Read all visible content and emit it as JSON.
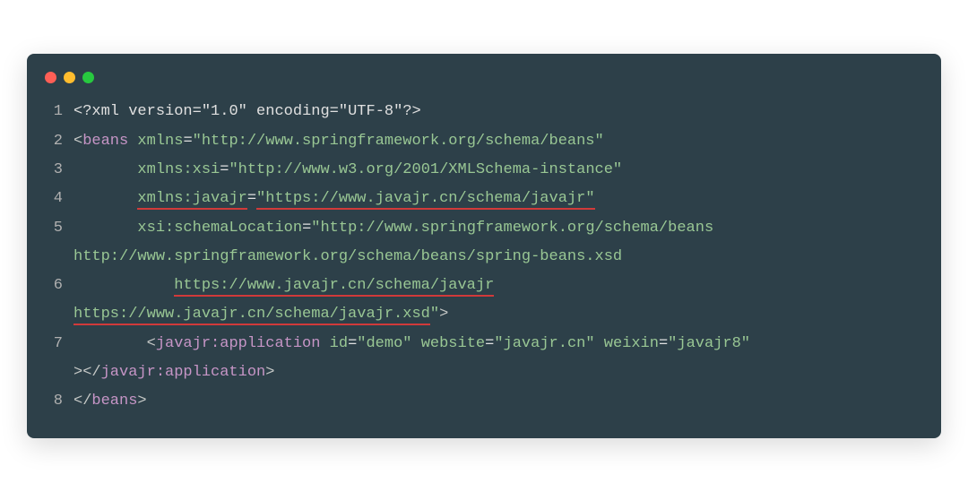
{
  "titlebar": {
    "dots": [
      "red",
      "yellow",
      "green"
    ]
  },
  "code": {
    "l1": {
      "pi_open": "<?",
      "pi_name": "xml",
      "version_attr": " version=",
      "version_val": "\"1.0\"",
      "encoding_attr": " encoding=",
      "encoding_val": "\"UTF-8\"",
      "pi_close": "?>"
    },
    "l2": {
      "open": "<",
      "tag": "beans",
      "attr": " xmlns",
      "eq": "=",
      "val": "\"http://www.springframework.org/schema/beans\""
    },
    "l3": {
      "indent": "       ",
      "attr": "xmlns:xsi",
      "eq": "=",
      "val": "\"http://www.w3.org/2001/XMLSchema-instance\""
    },
    "l4": {
      "indent": "       ",
      "attr": "xmlns:javajr",
      "eq": "=",
      "q1": "\"",
      "url": "https://www.javajr.cn/schema/javajr",
      "q2": "\""
    },
    "l5": {
      "indent": "       ",
      "attr": "xsi:schemaLocation",
      "eq": "=",
      "q1": "\"",
      "url1": "http://www.springframework.org/schema/beans",
      "cont": "http://www.springframework.org/schema/beans/spring-beans.xsd"
    },
    "l6": {
      "indent": "           ",
      "url": "https://www.javajr.cn/schema/javajr",
      "cont": "https://www.javajr.cn/schema/javajr.xsd",
      "q2": "\"",
      "close": ">"
    },
    "l7": {
      "indent": "        ",
      "open": "<",
      "tag": "javajr:application",
      "attr1": " id",
      "eq": "=",
      "val1": "\"demo\"",
      "attr2": " website",
      "val2": "\"javajr.cn\"",
      "attr3": " weixin",
      "val3": "\"javajr8\"",
      "cont_open": "><",
      "cont_slash": "/",
      "cont_tag": "javajr:application",
      "cont_close": ">"
    },
    "l8": {
      "open": "</",
      "tag": "beans",
      "close": ">"
    },
    "linenos": [
      "1",
      "2",
      "3",
      "4",
      "5",
      "6",
      "7",
      "8"
    ]
  }
}
